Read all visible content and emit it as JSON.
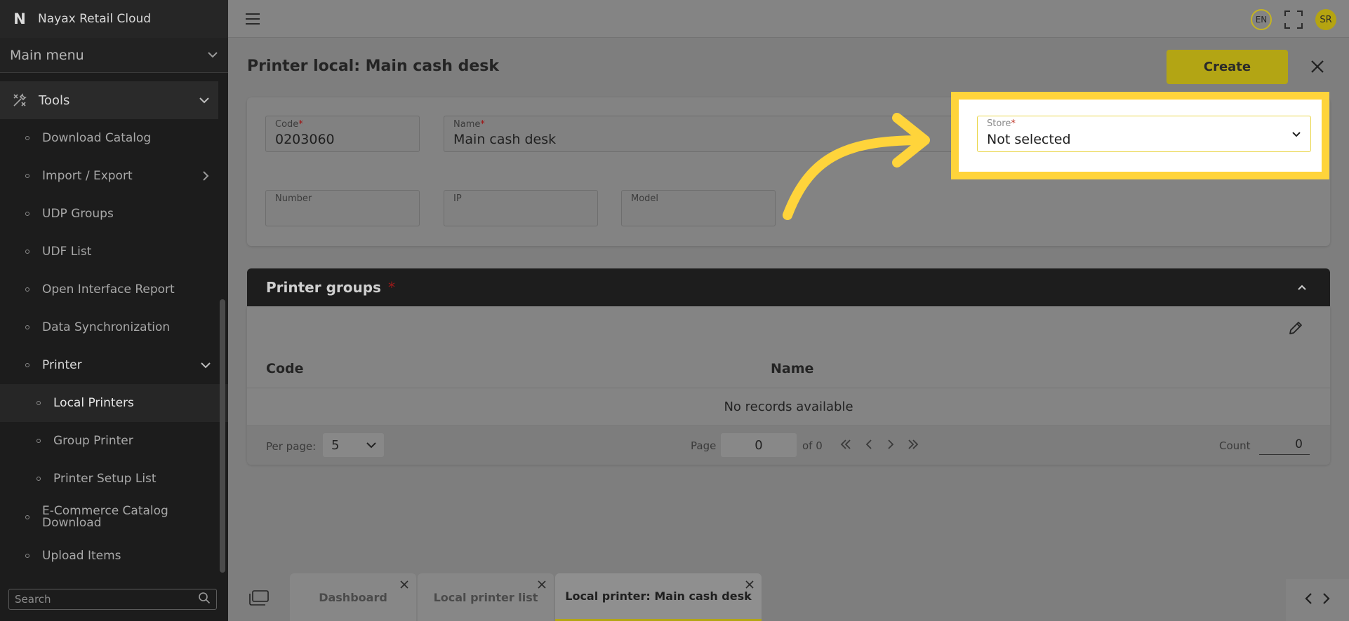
{
  "app": {
    "name": "Nayax Retail Cloud",
    "logo_letter": "N"
  },
  "sidebar": {
    "main_menu_label": "Main menu",
    "tools_label": "Tools",
    "items": [
      {
        "label": "Download Catalog"
      },
      {
        "label": "Import / Export"
      },
      {
        "label": "UDP Groups"
      },
      {
        "label": "UDF List"
      },
      {
        "label": "Open Interface Report"
      },
      {
        "label": "Data Synchronization"
      },
      {
        "label": "Printer"
      },
      {
        "label": "Local Printers"
      },
      {
        "label": "Group Printer"
      },
      {
        "label": "Printer Setup List"
      },
      {
        "label": "E-Commerce Catalog Download"
      },
      {
        "label": "Upload Items"
      }
    ],
    "search_placeholder": "Search"
  },
  "topbar": {
    "language": "EN",
    "user_initials": "SR"
  },
  "page": {
    "title": "Printer local: Main cash desk",
    "create_label": "Create"
  },
  "form": {
    "code": {
      "label": "Code",
      "value": "0203060"
    },
    "name": {
      "label": "Name",
      "value": "Main cash desk"
    },
    "store": {
      "label": "Store",
      "value": "Not selected"
    },
    "number": {
      "label": "Number",
      "value": ""
    },
    "ip": {
      "label": "IP",
      "value": ""
    },
    "model": {
      "label": "Model",
      "value": ""
    },
    "required_mark": "*"
  },
  "printer_groups": {
    "title": "Printer groups",
    "required_mark": "*",
    "columns": [
      "Code",
      "Name"
    ],
    "empty_text": "No records available",
    "per_page_label": "Per page:",
    "per_page_value": "5",
    "page_label": "Page",
    "page_value": "0",
    "of_label": "of 0",
    "count_label": "Count",
    "count_value": "0"
  },
  "tabs": [
    {
      "label": "Dashboard"
    },
    {
      "label": "Local printer list"
    },
    {
      "label": "Local printer: Main cash desk"
    }
  ],
  "colors": {
    "accent": "#b3a514",
    "highlight": "#ffd43b",
    "required": "#c0392b"
  }
}
